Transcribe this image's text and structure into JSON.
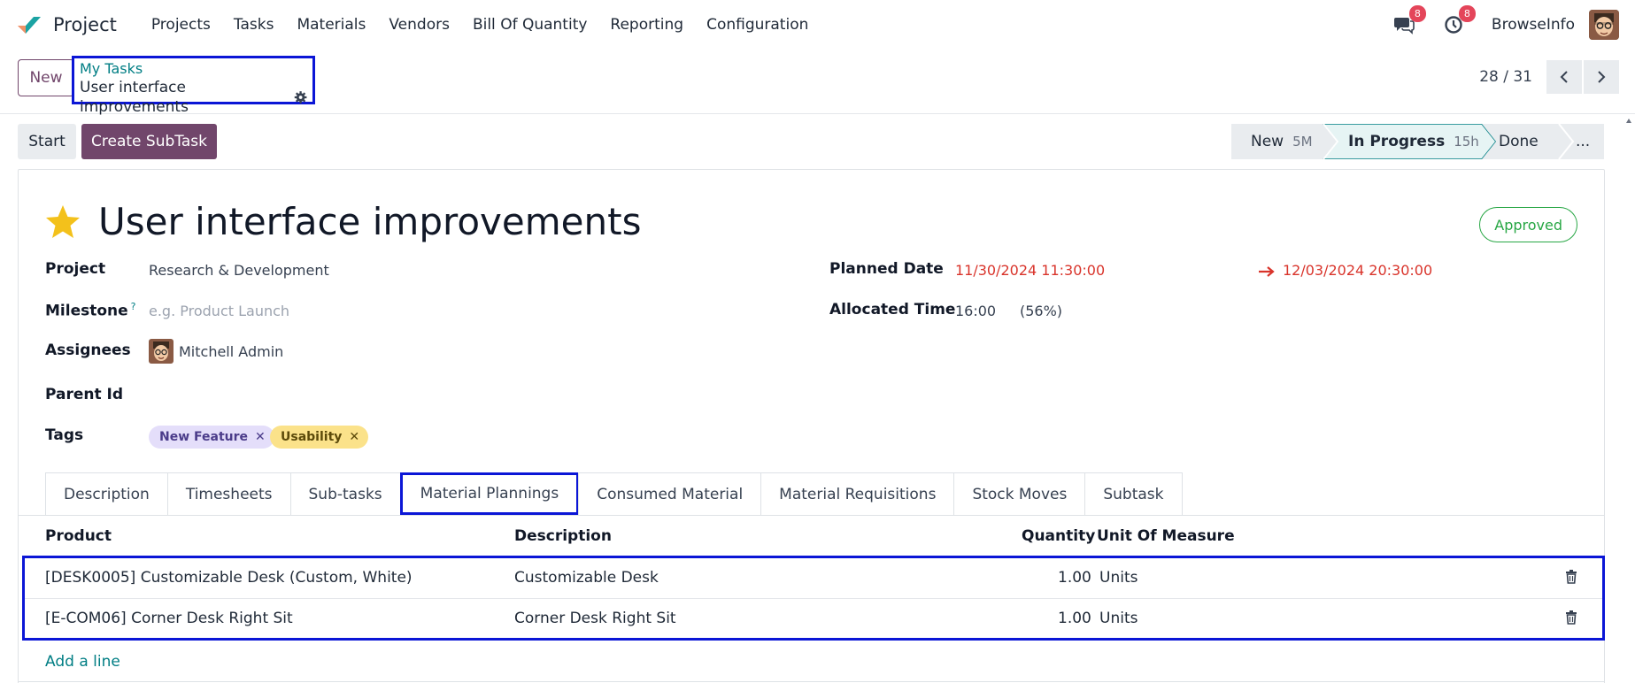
{
  "app": {
    "name": "Project",
    "menu": [
      "Projects",
      "Tasks",
      "Materials",
      "Vendors",
      "Bill Of Quantity",
      "Reporting",
      "Configuration"
    ],
    "messages_badge": "8",
    "activities_badge": "8",
    "company": "BrowseInfo"
  },
  "control": {
    "new_label": "New",
    "breadcrumb_parent": "My Tasks",
    "breadcrumb_current": "User interface improvements",
    "pager": "28 / 31"
  },
  "actions": {
    "start_label": "Start",
    "create_subtask_label": "Create SubTask"
  },
  "stages": [
    {
      "label": "New",
      "duration": "5M",
      "active": false
    },
    {
      "label": "In Progress",
      "duration": "15h",
      "active": true
    },
    {
      "label": "Done",
      "duration": "",
      "active": false
    },
    {
      "label": "...",
      "duration": "",
      "active": false
    }
  ],
  "task": {
    "title": "User interface improvements",
    "status_badge": "Approved",
    "starred": true,
    "fields": {
      "project_label": "Project",
      "project_value": "Research & Development",
      "milestone_label": "Milestone",
      "milestone_help": "?",
      "milestone_placeholder": "e.g. Product Launch",
      "assignees_label": "Assignees",
      "assignee_name": "Mitchell Admin",
      "parent_label": "Parent Id",
      "tags_label": "Tags",
      "planned_label": "Planned Date",
      "planned_start": "11/30/2024 11:30:00",
      "planned_end": "12/03/2024 20:30:00",
      "allocated_label": "Allocated Time",
      "allocated_value": "16:00",
      "allocated_percent": "(56%)"
    },
    "tags": [
      {
        "label": "New Feature",
        "bg": "#e4defa",
        "fg": "#4b3c8a"
      },
      {
        "label": "Usability",
        "bg": "#fbe28a",
        "fg": "#5c4a0a"
      }
    ]
  },
  "tabs": [
    "Description",
    "Timesheets",
    "Sub-tasks",
    "Material Plannings",
    "Consumed Material",
    "Material Requisitions",
    "Stock Moves",
    "Subtask"
  ],
  "active_tab": "Material Plannings",
  "table": {
    "headers": {
      "product": "Product",
      "description": "Description",
      "quantity": "Quantity",
      "uom": "Unit Of Measure"
    },
    "rows": [
      {
        "product": "[DESK0005] Customizable Desk (Custom, White)",
        "description": "Customizable Desk",
        "quantity": "1.00",
        "uom": "Units"
      },
      {
        "product": "[E-COM06] Corner Desk Right Sit",
        "description": "Corner Desk Right Sit",
        "quantity": "1.00",
        "uom": "Units"
      }
    ],
    "add_line": "Add a line"
  },
  "colors": {
    "brand": "#71466b",
    "link": "#017e84",
    "highlight": "#0b16d6",
    "danger": "#d9342b",
    "success": "#28a745"
  }
}
